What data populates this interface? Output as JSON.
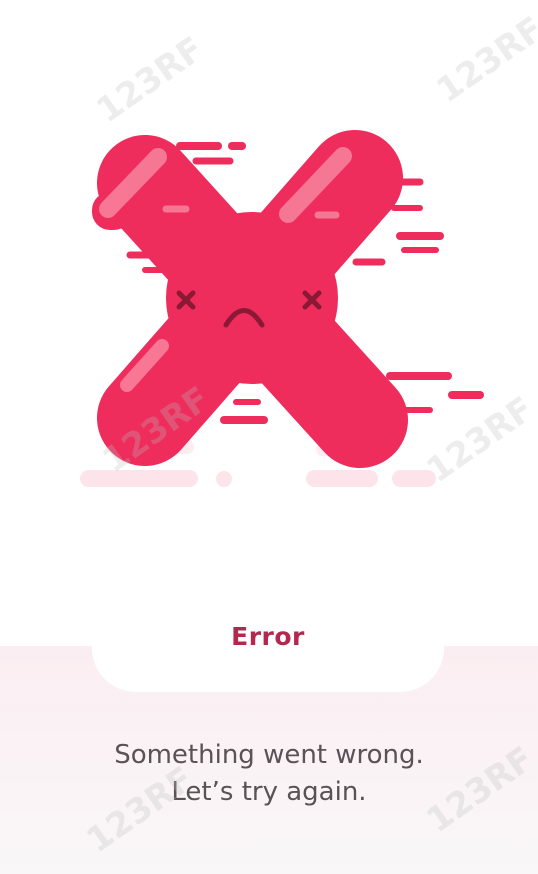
{
  "error": {
    "title": "Error",
    "message_line1": "Something went wrong.",
    "message_line2": "Let’s try again."
  },
  "illustration": {
    "icon": "sad-x-mascot-icon",
    "main_color": "#ee2d5c",
    "highlight_color": "#f4738f",
    "face_color": "#8b1834"
  },
  "watermark": {
    "text": "123RF"
  },
  "colors": {
    "title": "#b3284f",
    "message": "#5a5256",
    "panel": "#fbeef2"
  }
}
